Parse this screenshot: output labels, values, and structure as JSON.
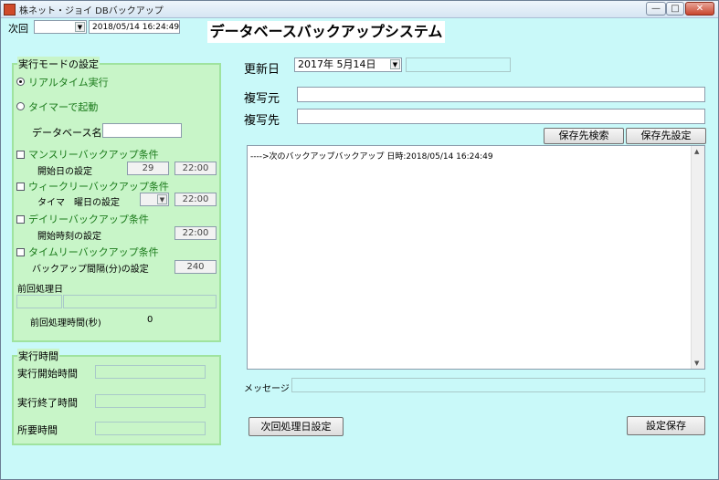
{
  "window": {
    "title": "株ネット・ジョイ DBバックアップ",
    "minimize": "—",
    "maximize": "□",
    "close": "✕"
  },
  "top": {
    "next_label": "次回",
    "next_datetime": "2018/05/14 16:24:49"
  },
  "banner": "データベースバックアップシステム",
  "run_mode": {
    "title": "実行モードの設定",
    "realtime": "リアルタイム実行",
    "timer": "タイマーで起動",
    "db_name_label": "データベース名",
    "db_name_value": ""
  },
  "monthly": {
    "label": "マンスリーバックアップ条件",
    "sub_label": "開始日の設定",
    "day": "29",
    "time": "22:00"
  },
  "weekly": {
    "label": "ウィークリーバックアップ条件",
    "sub_label": "タイマ　曜日の設定",
    "time": "22:00"
  },
  "daily": {
    "label": "デイリーバックアップ条件",
    "sub_label": "開始時刻の設定",
    "time": "22:00"
  },
  "timely": {
    "label": "タイムリーバックアップ条件",
    "sub_label": "バックアップ間隔(分)の設定",
    "interval": "240"
  },
  "prev": {
    "date_label": "前回処理日",
    "time_label": "前回処理時間(秒)",
    "time_value": "0"
  },
  "exec": {
    "title": "実行時間",
    "start_label": "実行開始時間",
    "end_label": "実行終了時間",
    "duration_label": "所要時間"
  },
  "main": {
    "update_label": "更新日",
    "update_date": "2017年 5月14日",
    "source_label": "複写元",
    "source_value": "",
    "dest_label": "複写先",
    "dest_value": "",
    "search_button": "保存先検索",
    "set_button": "保存先設定",
    "log_line": "---->次のバックアップバックアップ 日時:2018/05/14 16:24:49",
    "message_label": "メッセージ",
    "message_value": "",
    "next_date_button": "次回処理日設定",
    "save_button": "設定保存"
  }
}
